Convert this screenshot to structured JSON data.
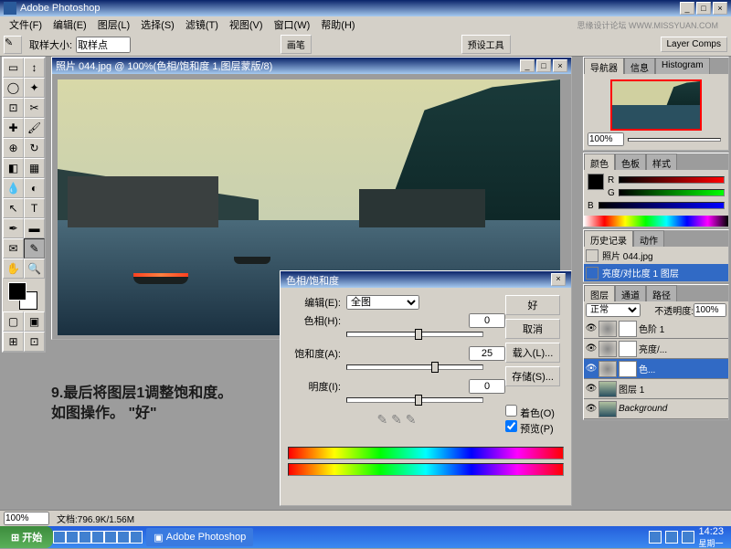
{
  "titlebar": {
    "title": "Adobe Photoshop"
  },
  "menu": {
    "file": "文件(F)",
    "edit": "编辑(E)",
    "image": "图层(L)",
    "select": "选择(S)",
    "filter": "滤镜(T)",
    "view": "视图(V)",
    "window": "窗口(W)",
    "help": "帮助(H)",
    "watermark": "思缘设计论坛 WWW.MISSYUAN.COM"
  },
  "optbar": {
    "lbl": "取样大小:",
    "value": "取样点",
    "palette1": "画笔",
    "palette2": "预设工具",
    "palette3": "Layer Comps"
  },
  "docwin": {
    "title": "照片 044.jpg @ 100%(色相/饱和度 1,图层蒙版/8)"
  },
  "instr": {
    "line1": "9.最后将图层1调整饱和度。",
    "line2": "如图操作。  \"好\""
  },
  "dialog": {
    "title": "色相/饱和度",
    "edit_label": "编辑(E):",
    "edit_value": "全图",
    "hue_label": "色相(H):",
    "hue_value": "0",
    "sat_label": "饱和度(A):",
    "sat_value": "25",
    "light_label": "明度(I):",
    "light_value": "0",
    "ok": "好",
    "cancel": "取消",
    "load": "载入(L)...",
    "save": "存储(S)...",
    "colorize": "着色(O)",
    "preview": "预览(P)"
  },
  "nav": {
    "tab1": "导航器",
    "tab2": "信息",
    "tab3": "Histogram",
    "zoom": "100%"
  },
  "color": {
    "tab1": "颜色",
    "tab2": "色板",
    "tab3": "样式",
    "r": "R",
    "g": "G",
    "b": "B"
  },
  "history": {
    "tab1": "历史记录",
    "tab2": "动作",
    "item1": "照片 044.jpg",
    "item2": "亮度/对比度 1 图层"
  },
  "layers": {
    "tab1": "图层",
    "tab2": "通道",
    "tab3": "路径",
    "mode": "正常",
    "opacity_label": "不透明度:",
    "opacity": "100%",
    "l1": "色阶 1",
    "l2": "亮度/...",
    "l3": "色...",
    "l4": "图层 1",
    "l5": "Background"
  },
  "status": {
    "zoom": "100%",
    "docinfo": "文档:796.9K/1.56M"
  },
  "taskbar": {
    "start": "开始",
    "app": "Adobe Photoshop",
    "time": "14:23",
    "day": "星期一"
  }
}
